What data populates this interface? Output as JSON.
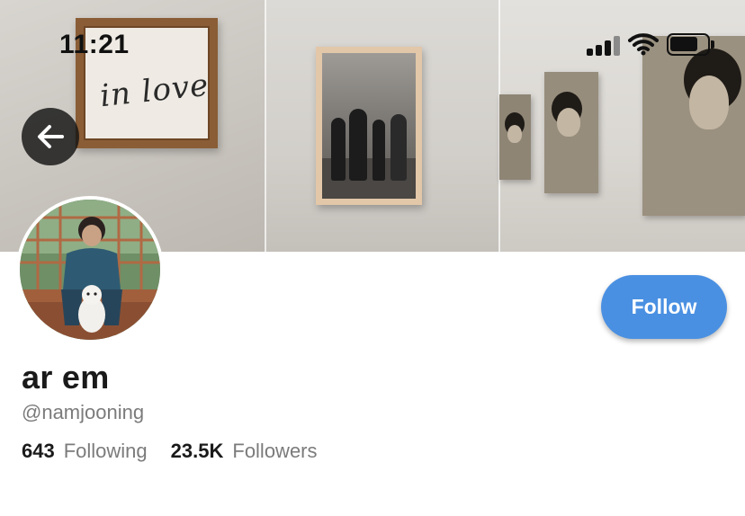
{
  "status_bar": {
    "time": "11:21",
    "signal_icon": "cellular-signal-icon",
    "wifi_icon": "wifi-icon",
    "battery_icon": "battery-icon"
  },
  "banner": {
    "frame_script_text": "in love"
  },
  "navigation": {
    "back_icon": "arrow-left-icon"
  },
  "profile": {
    "display_name": "ar em",
    "handle": "@namjooning",
    "follow_label": "Follow",
    "following_count": "643",
    "following_label": "Following",
    "followers_count": "23.5K",
    "followers_label": "Followers"
  },
  "colors": {
    "accent": "#4a90e2",
    "text_primary": "#1a1a1a",
    "text_secondary": "#7b7b7b"
  }
}
